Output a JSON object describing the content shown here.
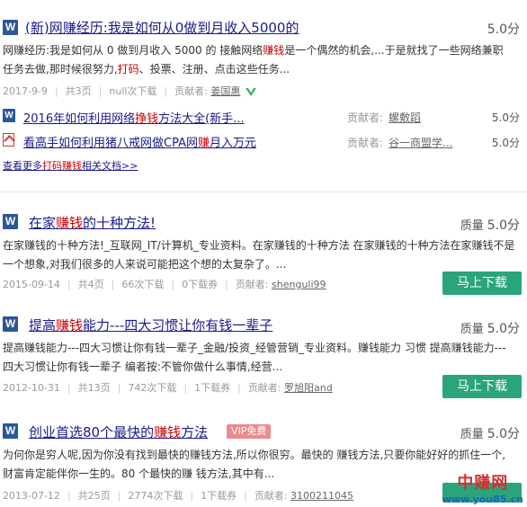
{
  "doc1": {
    "title": "(新)网赚经历:我是如何从0做到月收入5000的",
    "score": "5.0分",
    "desc_line1_a": "网赚经历:我是如何从 0 做到月收入 5000 的 接触网络",
    "desc_line1_hl": "赚钱",
    "desc_line1_b": "是一个偶然的机会,...于是就找了一些网络兼职",
    "desc_line2_a": "任务去做,那时候很努力,",
    "desc_line2_hl": "打码",
    "desc_line2_b": "、投票、注册、点击这些任务...",
    "date": "2017-9-9",
    "pages": "共3页",
    "downloads": "null次下载",
    "contributor_label": "贡献者:",
    "contributor": "姜国惠"
  },
  "related": [
    {
      "title_a": "2016年如何利用网络",
      "title_hl": "挣钱",
      "title_b": "方法大全(新手...",
      "contributor_label": "贡献者:",
      "contributor": "螺敷蹈",
      "score": "5.0分"
    },
    {
      "title_a": "看高手如何利用猪八戒网做CPA网",
      "title_hl": "赚",
      "title_b": "月入万元",
      "contributor_label": "贡献者:",
      "contributor": "谷一商盟学...",
      "score": "5.0分"
    }
  ],
  "more_link": {
    "a": "查看更多",
    "hl": "打码赚钱",
    "b": "相关文档>>"
  },
  "doc2": {
    "title_a": "在家",
    "title_hl": "赚钱",
    "title_b": "的十种方法!",
    "score_label": "质量",
    "score": "5.0分",
    "desc_line1": "在家赚钱的十种方法!_互联网_IT/计算机_专业资料。在家赚钱的十种方法 在家赚钱的十种方法在家赚钱不是",
    "desc_line2": "一个想象,对我们很多的人来说可能把这个想的太复杂了。...",
    "date": "2015-09-14",
    "pages": "共4页",
    "downloads": "66次下载",
    "coupons": "0下载券",
    "contributor_label": "贡献者:",
    "contributor": "shenguli99",
    "button": "马上下载"
  },
  "doc3": {
    "title_a": "提高",
    "title_hl": "赚钱",
    "title_b": "能力---四大习惯让你有钱一辈子",
    "score_label": "质量",
    "score": "5.0分",
    "desc_line1": "提高赚钱能力---四大习惯让你有钱一辈子_金融/投资_经管营销_专业资料。赚钱能力 习惯 提高赚钱能力---",
    "desc_line2": "四大习惯让你有钱一辈子 编者按:不管你做什么事情,经营...",
    "date": "2012-10-31",
    "pages": "共13页",
    "downloads": "742次下载",
    "coupons": "1下载券",
    "contributor_label": "贡献者:",
    "contributor": "罗旭阳and",
    "button": "马上下载"
  },
  "doc4": {
    "title_a": "创业首选80个最快的",
    "title_hl": "赚钱",
    "title_b": "方法",
    "vip": "VIP免费",
    "score_label": "质量",
    "score": "5.0分",
    "desc_line1": "为何你是穷人呢,因为你没有找到最快的赚钱方法,所以你很穷。最快的 赚钱方法,只要你能好好的抓住一个,",
    "desc_line2": "财富肯定能伴你一生的。80 个最快的赚 钱方法,其中有...",
    "date": "2013-07-12",
    "pages": "共25页",
    "downloads": "2774次下载",
    "coupons": "1下载券",
    "contributor_label": "贡献者:",
    "contributor": "3100211045"
  },
  "watermark": {
    "top": "中赚网",
    "bottom": "www.you85.cn"
  },
  "colors": {
    "title": "#1a1a8c",
    "highlight": "#cc0000",
    "button": "#2aa57a",
    "vip": "#ec8a8a"
  }
}
